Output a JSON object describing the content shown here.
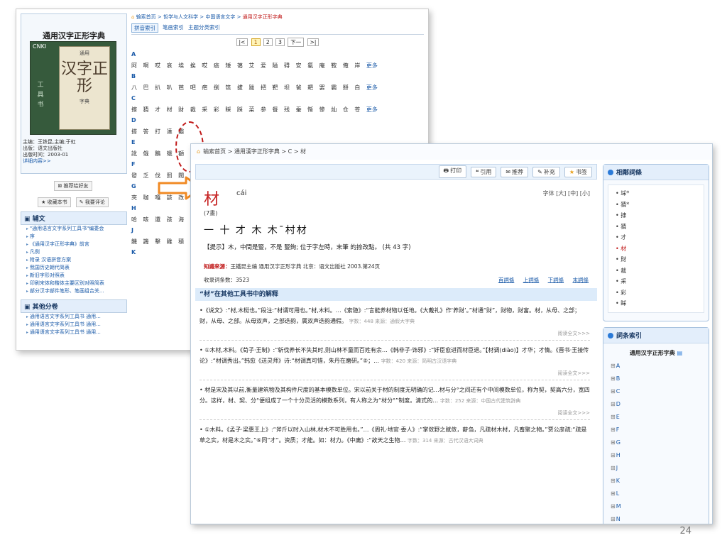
{
  "back_window": {
    "book_title": "通用汉字正形字典",
    "cover": {
      "brand": "CNKI",
      "side_text": "工具书",
      "small_text": "通用",
      "big_text": "汉字正形",
      "bottom_text": "字典"
    },
    "meta": [
      "主编：王铁昆,主编;于虹",
      "出版：语文出版社",
      "出版时间：2003-01"
    ],
    "detail_link": "详细内容>>",
    "recommend_btn": "推荐给好友",
    "fav_btn": "收藏本书",
    "comment_btn": "我要评论",
    "section_aux": "辅文",
    "aux_items": [
      "\"通用语言文字系列工具书\"编委会",
      "序",
      "《通用汉字正形字典》前言",
      "凡例",
      "附录 汉语拼音方案",
      "我国历史朝代简表",
      "新旧字形对照表",
      "印刷宋体和楷体主要区别对照简表",
      "部分汉字部件笔形、笔画组合关..."
    ],
    "section_other": "其他分卷",
    "other_items": [
      "通用语言文字系列工具书 通用...",
      "通用语言文字系列工具书 通用...",
      "通用语言文字系列工具书 通用..."
    ],
    "breadcrumb": [
      "输索首页",
      "哲学与人文科学",
      "中国语言文字",
      "通用汉字正形字典"
    ],
    "tabs": [
      "拼音索引",
      "笔画索引",
      "主题分类索引"
    ],
    "pager": [
      "|<",
      "1",
      "2",
      "3",
      "下一",
      ">|"
    ],
    "letters": [
      {
        "letter": "A",
        "chars": "阿 啊 哎 哀 埃 挨 哎 癌 矮 蔼 艾 爱 隘 碍 安 氨 庵 鞍 俺 岸",
        "more": "更多"
      },
      {
        "letter": "B",
        "chars": "八 巴 扒 叭 芭 吧 疤 捌 笆 拔 跋 把 靶 坝 爸 耙 罢 霸 掰 白",
        "more": "更多"
      },
      {
        "letter": "C",
        "chars": "擦 猜 才 材 财 裁 采 彩 睬 踩 菜 参 餐 残 蚕 惭 惨 灿 仓 苍",
        "more": "更多"
      },
      {
        "letter": "D",
        "chars": "搭 答 打 達 霸",
        "more": ""
      },
      {
        "letter": "E",
        "chars": "訛 俄 鵝 蛾 額",
        "more": ""
      },
      {
        "letter": "F",
        "chars": "發 乏 伐 罰 閥",
        "more": ""
      },
      {
        "letter": "G",
        "chars": "夾 咖 嘎 該 改",
        "more": ""
      },
      {
        "letter": "H",
        "chars": "哈 咳 還 孩 海",
        "more": ""
      },
      {
        "letter": "J",
        "chars": "饑 譏 擊 雞 積",
        "more": ""
      },
      {
        "letter": "K",
        "chars": "",
        "more": ""
      }
    ]
  },
  "front_window": {
    "breadcrumb": "输索首页 > 通用漢字正形字典 > C > 材",
    "toolbar": [
      {
        "icon": "print-icon",
        "label": "打印",
        "glyph": "🖶"
      },
      {
        "icon": "cite-icon",
        "label": "引用",
        "glyph": "❝"
      },
      {
        "icon": "recommend-icon",
        "label": "推荐",
        "glyph": "✉"
      },
      {
        "icon": "pencil-icon",
        "label": "补充",
        "glyph": "✎"
      },
      {
        "icon": "star-icon",
        "label": "书签",
        "glyph": "★"
      }
    ],
    "headword": "材",
    "pinyin": "cái",
    "font_size_label": "字体 [大] [中] [小]",
    "strokes": "(7畫)",
    "stroke_order": "一 十 才 木 木ˉ村材",
    "hint": "【提示】木，中間是豎，不是 豎鉤; 位于字左時，末筆 的捺改點。 (共 43 字)",
    "source_label": "知識來源：",
    "source_text": "王鐵昆主编 通用汉字正形字典 北京：语文出版社 2003.第24页",
    "count_label": "收录词条数：",
    "count_value": "3523",
    "nav_links": [
      "首詞條",
      "上詞條",
      "下詞條",
      "末詞條"
    ],
    "explain_head": "“材”在其他工具书中的解释",
    "entries": [
      {
        "text": "•《说文》:“材,木梃也。”段注:“材谓可用也。”材,木料。…《索隐》:“言能养材物以任地。《大戴礼》作‘养财’。”材通“财”，财物，财富。材，从母、之部；财，从母、之部。从母双声，之部迭韵，属双声迭韵通假。",
        "meta": "字数：448  来源：通假大字典",
        "more": "阅读全文>>>"
      },
      {
        "text": "• ①木材,木料。《荀子·王制》:“斩伐养长不失其时,则山林不童而百姓有余…《韩非子·饰邪》:“奸臣愈进而材臣退。”【材调(diào)】才华；才情。《晋书·王接传论》:“材调秀出。”韩愈《送灵师》诗:“材调真可惜，朱丹在磨研。”⑤；…",
        "meta": "字数：420  来源：简明古汉语字典",
        "more": "阅读全文>>>"
      },
      {
        "text": "• 材是宋及其以前,衡量建筑物及其构件尺度的基本模数单位。宋以前关于材的制度无明确的记…材与分°之间还有个中间模数单位，称为契，契高六分，宽四分。这样，材、契、分°便组成了一个十分灵活的模数系列，有人称之为“材分°”制度。清式的…",
        "meta": "字数：252  来源：中国古代建筑辞典",
        "more": "阅读全文>>>"
      },
      {
        "text": "• ①木料。《孟子·梁惠王上》:“斧斤以时入山林,材木不可胜用也。”…《周礼·地官·委人》:“掌敛野之赋敛，薪刍，凡疏材木材，凡畜聚之物。”贾公彦疏:“疏是草之实，材是木之实。”⑥同“才”。资质；才能。如：材力。《中庸》:“故天之生物…",
        "meta": "字数：314  来源：古代汉语大词典",
        "more": ""
      }
    ],
    "near_head": "相鄰詞條",
    "near_items": [
      "埰*",
      "猜*",
      "捸",
      "猜",
      "才",
      "材",
      "財",
      "裁",
      "采",
      "彩",
      "睬"
    ],
    "near_current": "材",
    "index_head": "詞条索引",
    "index_dict": "通用汉字正形字典",
    "index_letters": [
      "A",
      "B",
      "C",
      "D",
      "E",
      "F",
      "G",
      "H",
      "J",
      "K",
      "L",
      "M",
      "N"
    ]
  },
  "page_number": "24"
}
